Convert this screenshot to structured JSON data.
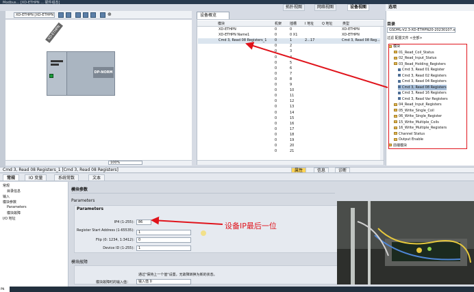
{
  "title_bar": {
    "text": "Modbus... [XD-ETHPN ... 硬件组态]"
  },
  "view_tabs": [
    {
      "label": "拓扑视图",
      "active": false
    },
    {
      "label": "网络视图",
      "active": false
    },
    {
      "label": "设备视图",
      "active": true
    }
  ],
  "graphic": {
    "device_select": "XD-ETHPN [XD-ETHPN]",
    "device_label": "XD-ETHPN",
    "module_label": "DP-NORM",
    "zoom": "100%"
  },
  "overview": {
    "tab_label": "设备概览",
    "columns": [
      "模块",
      "机架",
      "插槽",
      "I 地址",
      "Q 地址",
      "类型"
    ],
    "rows": [
      {
        "module": "XD-ETHPN",
        "rack": "0",
        "slot": "0",
        "i": "",
        "q": "",
        "type": "XD-ETHPN",
        "selected": false
      },
      {
        "module": "XD-ETHPN Name1",
        "rack": "0",
        "slot": "0 X1",
        "i": "",
        "q": "",
        "type": "XD-ETHPN",
        "selected": false
      },
      {
        "module": "Cmd 3, Read 08 Registers_1",
        "rack": "0",
        "slot": "1",
        "i": "2...17",
        "q": "",
        "type": "Cmd 3, Read 08 Reg...",
        "selected": true
      },
      {
        "module": "",
        "rack": "0",
        "slot": "2",
        "i": "",
        "q": "",
        "type": "",
        "selected": false
      },
      {
        "module": "",
        "rack": "0",
        "slot": "3",
        "i": "",
        "q": "",
        "type": "",
        "selected": false
      },
      {
        "module": "",
        "rack": "0",
        "slot": "4",
        "i": "",
        "q": "",
        "type": "",
        "selected": false
      },
      {
        "module": "",
        "rack": "0",
        "slot": "5",
        "i": "",
        "q": "",
        "type": "",
        "selected": false
      },
      {
        "module": "",
        "rack": "0",
        "slot": "6",
        "i": "",
        "q": "",
        "type": "",
        "selected": false
      },
      {
        "module": "",
        "rack": "0",
        "slot": "7",
        "i": "",
        "q": "",
        "type": "",
        "selected": false
      },
      {
        "module": "",
        "rack": "0",
        "slot": "8",
        "i": "",
        "q": "",
        "type": "",
        "selected": false
      },
      {
        "module": "",
        "rack": "0",
        "slot": "9",
        "i": "",
        "q": "",
        "type": "",
        "selected": false
      },
      {
        "module": "",
        "rack": "0",
        "slot": "10",
        "i": "",
        "q": "",
        "type": "",
        "selected": false
      },
      {
        "module": "",
        "rack": "0",
        "slot": "11",
        "i": "",
        "q": "",
        "type": "",
        "selected": false
      },
      {
        "module": "",
        "rack": "0",
        "slot": "12",
        "i": "",
        "q": "",
        "type": "",
        "selected": false
      },
      {
        "module": "",
        "rack": "0",
        "slot": "13",
        "i": "",
        "q": "",
        "type": "",
        "selected": false
      },
      {
        "module": "",
        "rack": "0",
        "slot": "14",
        "i": "",
        "q": "",
        "type": "",
        "selected": false
      },
      {
        "module": "",
        "rack": "0",
        "slot": "15",
        "i": "",
        "q": "",
        "type": "",
        "selected": false
      },
      {
        "module": "",
        "rack": "0",
        "slot": "16",
        "i": "",
        "q": "",
        "type": "",
        "selected": false
      },
      {
        "module": "",
        "rack": "0",
        "slot": "17",
        "i": "",
        "q": "",
        "type": "",
        "selected": false
      },
      {
        "module": "",
        "rack": "0",
        "slot": "18",
        "i": "",
        "q": "",
        "type": "",
        "selected": false
      },
      {
        "module": "",
        "rack": "0",
        "slot": "19",
        "i": "",
        "q": "",
        "type": "",
        "selected": false
      },
      {
        "module": "",
        "rack": "0",
        "slot": "20",
        "i": "",
        "q": "",
        "type": "",
        "selected": false
      },
      {
        "module": "",
        "rack": "0",
        "slot": "21",
        "i": "",
        "q": "",
        "type": "",
        "selected": false
      }
    ]
  },
  "catalog": {
    "title": "选项",
    "subtitle": "目录",
    "path": "GSDML-V2.3-XD-ETHPN20-20230107.xml",
    "filter": "过滤     配置文件 <全部>",
    "tree": [
      {
        "label": "模块",
        "kind": "folder",
        "selected": false
      },
      {
        "label": "01_Read_Coil_Status",
        "kind": "folder",
        "selected": false
      },
      {
        "label": "02_Read_Input_Status",
        "kind": "folder",
        "selected": false
      },
      {
        "label": "03_Read_Holding_Registers",
        "kind": "folder",
        "selected": false
      },
      {
        "label": "Cmd 3, Read 01 Register",
        "kind": "module",
        "selected": false
      },
      {
        "label": "Cmd 3, Read 02 Registers",
        "kind": "module",
        "selected": false
      },
      {
        "label": "Cmd 3, Read 04 Registers",
        "kind": "module",
        "selected": false
      },
      {
        "label": "Cmd 3, Read 08 Registers",
        "kind": "module",
        "selected": true
      },
      {
        "label": "Cmd 3, Read 16 Registers",
        "kind": "module",
        "selected": false
      },
      {
        "label": "Cmd 3, Read Var Registers",
        "kind": "module",
        "selected": false
      },
      {
        "label": "04_Read_Input_Registers",
        "kind": "folder",
        "selected": false
      },
      {
        "label": "05_Write_Single_Coil",
        "kind": "folder",
        "selected": false
      },
      {
        "label": "06_Write_Single_Register",
        "kind": "folder",
        "selected": false
      },
      {
        "label": "15_Write_Multiple_Coils",
        "kind": "folder",
        "selected": false
      },
      {
        "label": "16_Write_Multiple_Registers",
        "kind": "folder",
        "selected": false
      },
      {
        "label": "Channel Status",
        "kind": "folder",
        "selected": false
      },
      {
        "label": "Output Enable",
        "kind": "folder",
        "selected": false
      },
      {
        "label": "前端模块",
        "kind": "folder",
        "selected": false
      }
    ]
  },
  "properties": {
    "title": "Cmd 3, Read 08 Registers_1 [Cmd 3, Read 08 Registers]",
    "top_tabs": [
      {
        "label": "属性",
        "active": true
      },
      {
        "label": "信息",
        "active": false
      },
      {
        "label": "诊断",
        "active": false
      }
    ],
    "sub_tabs": [
      {
        "label": "常规",
        "active": true
      },
      {
        "label": "IO 变量",
        "active": false
      },
      {
        "label": "系统常数",
        "active": false
      },
      {
        "label": "文本",
        "active": false
      }
    ],
    "nav": [
      "常规",
      "目录信息",
      "输入",
      "模块参数",
      "Parameters",
      "模块故障",
      "I/O 地址"
    ],
    "section_title": "模块参数",
    "group_title": "Parameters",
    "params_heading": "Parameters",
    "fields": [
      {
        "label": "IP4 (1-255):",
        "value": "86"
      },
      {
        "label": "Register Start Address (1-65535):",
        "value": "1"
      },
      {
        "label": "Flip (0: 1234, 1:3412):",
        "value": "0"
      },
      {
        "label": "Device ID (1-255):",
        "value": "1"
      }
    ],
    "fault_title": "模块故障",
    "fault_note": "通过\"保持上一个值\"设置，无故障转换为新的状态。",
    "fault_field_label": "模块故障时的输入值：",
    "fault_field_value": "输入值 0"
  },
  "annotation": {
    "text": "设备IP最后一位"
  },
  "status": {
    "tag": "PN"
  },
  "colors": {
    "accent_red": "#e0131b",
    "selected_blue": "#a9c0da",
    "tab_orange": "#ffd457"
  }
}
